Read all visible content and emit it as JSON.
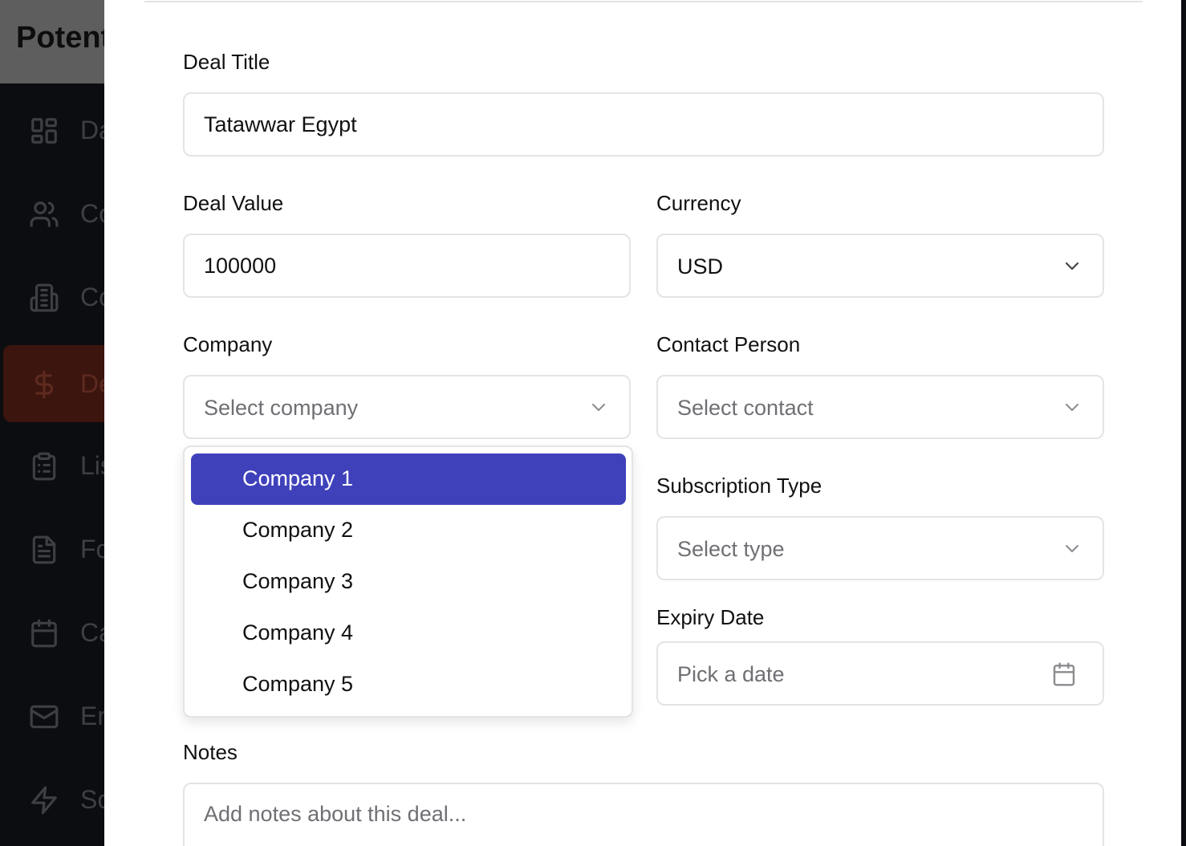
{
  "app": {
    "title": "Potent",
    "sidebar": [
      {
        "label": "Da",
        "icon": "dashboard-icon"
      },
      {
        "label": "Co",
        "icon": "users-icon"
      },
      {
        "label": "Co",
        "icon": "building-icon"
      },
      {
        "label": "De",
        "icon": "dollar-icon"
      },
      {
        "label": "Lis",
        "icon": "clipboard-icon"
      },
      {
        "label": "Fo",
        "icon": "file-icon"
      },
      {
        "label": "Ca",
        "icon": "calendar-icon"
      },
      {
        "label": "Em",
        "icon": "mail-icon"
      },
      {
        "label": "Sc",
        "icon": "zap-icon"
      }
    ]
  },
  "form": {
    "deal_title": {
      "label": "Deal Title",
      "value": "Tatawwar Egypt"
    },
    "deal_value": {
      "label": "Deal Value",
      "value": "100000"
    },
    "currency": {
      "label": "Currency",
      "value": "USD"
    },
    "company": {
      "label": "Company",
      "placeholder": "Select company",
      "options": [
        "Company 1",
        "Company 2",
        "Company 3",
        "Company 4",
        "Company 5"
      ],
      "highlighted": "Company 1"
    },
    "contact_person": {
      "label": "Contact Person",
      "placeholder": "Select contact"
    },
    "subscription_type": {
      "label": "Subscription Type",
      "placeholder": "Select type"
    },
    "expiry_date": {
      "label": "Expiry Date",
      "placeholder": "Pick a date"
    },
    "notes": {
      "label": "Notes",
      "placeholder": "Add notes about this deal..."
    }
  },
  "colors": {
    "accent": "#3f41bb",
    "border": "#e4e4e7",
    "active_nav_bg": "#3b150e"
  }
}
